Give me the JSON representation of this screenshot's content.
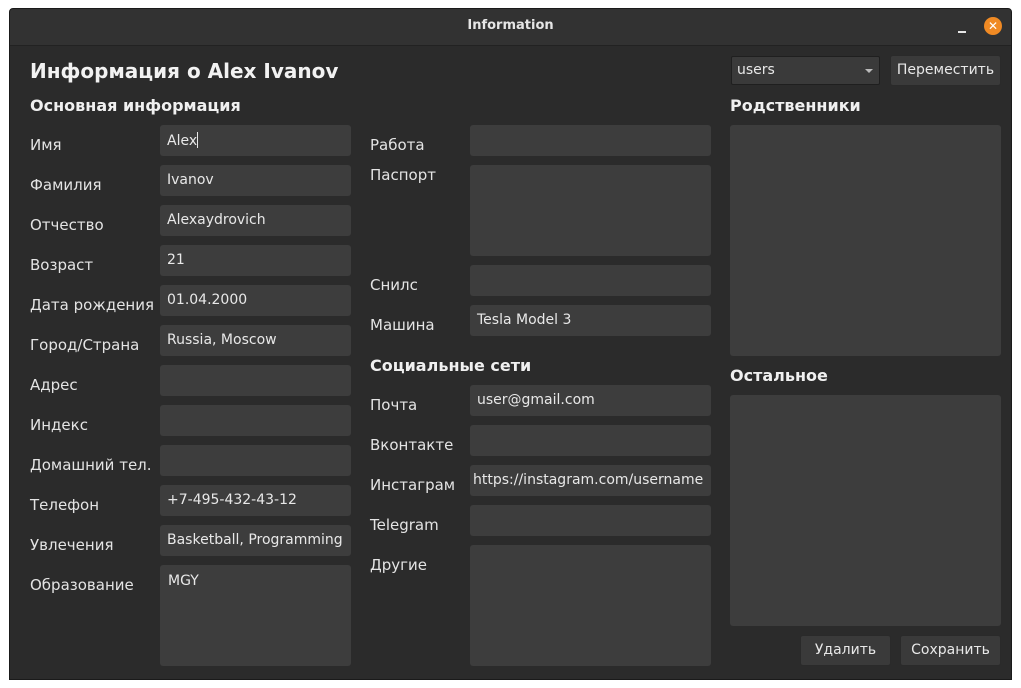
{
  "window": {
    "title": "Information"
  },
  "header": {
    "title": "Информация о Alex Ivanov"
  },
  "toolbar": {
    "group_select_value": "users",
    "move_label": "Переместить"
  },
  "basic": {
    "heading": "Основная информация",
    "fields": [
      {
        "label": "Имя",
        "value": "Alex"
      },
      {
        "label": "Фамилия",
        "value": "Ivanov"
      },
      {
        "label": "Отчество",
        "value": "Alexaydrovich"
      },
      {
        "label": "Возраст",
        "value": "21"
      },
      {
        "label": "Дата рождения",
        "value": "01.04.2000"
      },
      {
        "label": "Город/Страна",
        "value": "Russia, Moscow"
      },
      {
        "label": "Адрес",
        "value": ""
      },
      {
        "label": "Индекс",
        "value": ""
      },
      {
        "label": "Домашний тел.",
        "value": ""
      },
      {
        "label": "Телефон",
        "value": "+7-495-432-43-12"
      },
      {
        "label": "Увлечения",
        "value": "Basketball, Programming"
      },
      {
        "label": "Образование",
        "value": "MGY"
      }
    ]
  },
  "extra": {
    "work": {
      "label": "Работа",
      "value": ""
    },
    "passport": {
      "label": "Паспорт",
      "value": ""
    },
    "snils": {
      "label": "Снилс",
      "value": ""
    },
    "car": {
      "label": "Машина",
      "value": "Tesla Model 3"
    }
  },
  "social": {
    "heading": "Социальные сети",
    "mail": {
      "label": "Почта",
      "value": "user@gmail.com"
    },
    "vk": {
      "label": "Вконтакте",
      "value": ""
    },
    "instagram": {
      "label": "Инстаграм",
      "value": "https://instagram.com/username"
    },
    "telegram": {
      "label": "Telegram",
      "value": ""
    },
    "other": {
      "label": "Другие",
      "value": ""
    }
  },
  "relatives": {
    "heading": "Родственники",
    "value": ""
  },
  "rest": {
    "heading": "Остальное",
    "value": ""
  },
  "actions": {
    "delete_label": "Удалить",
    "save_label": "Сохранить"
  }
}
